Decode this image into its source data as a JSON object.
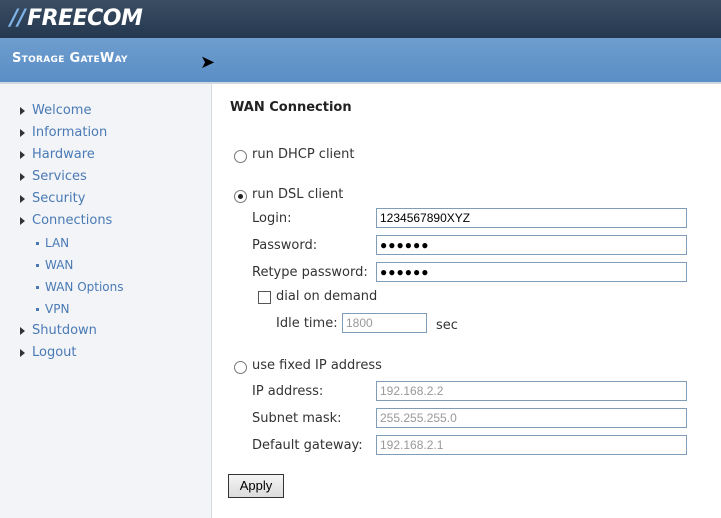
{
  "header": {
    "logo_text": "FREECOM",
    "subtitle": "Storage GateWay"
  },
  "sidebar": {
    "items": [
      {
        "label": "Welcome"
      },
      {
        "label": "Information"
      },
      {
        "label": "Hardware"
      },
      {
        "label": "Services"
      },
      {
        "label": "Security"
      },
      {
        "label": "Connections"
      }
    ],
    "subitems": [
      {
        "label": "LAN"
      },
      {
        "label": "WAN"
      },
      {
        "label": "WAN Options"
      },
      {
        "label": "VPN"
      }
    ],
    "items_after": [
      {
        "label": "Shutdown"
      },
      {
        "label": "Logout"
      }
    ]
  },
  "main": {
    "title": "WAN Connection",
    "dhcp_label": "run DHCP client",
    "dsl_label": "run DSL client",
    "login_label": "Login:",
    "login_value": "1234567890XYZ",
    "password_label": "Password:",
    "password_mask": "●●●●●●",
    "retype_label": "Retype password:",
    "retype_mask": "●●●●●●",
    "dial_label": "dial on demand",
    "idle_label": "Idle time:",
    "idle_value": "1800",
    "idle_unit": "sec",
    "fixed_label": "use fixed IP address",
    "ip_label": "IP address:",
    "ip_value": "192.168.2.2",
    "subnet_label": "Subnet mask:",
    "subnet_value": "255.255.255.0",
    "gateway_label": "Default gateway:",
    "gateway_value": "192.168.2.1",
    "apply_label": "Apply",
    "selected_mode": "dsl",
    "dial_on_demand": false
  },
  "colors": {
    "header_dark": "#2a3d54",
    "header_blue": "#6393c9",
    "link": "#4a7ab5",
    "sidebar_bg": "#f2f4f7"
  }
}
